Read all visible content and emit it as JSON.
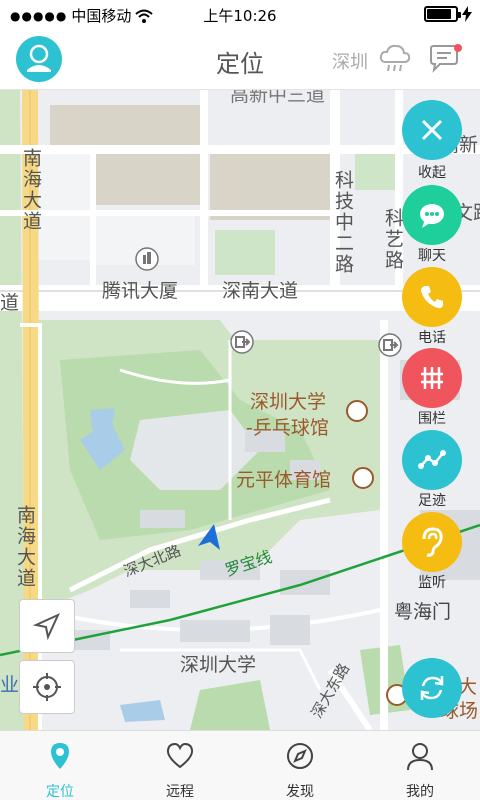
{
  "status_bar": {
    "carrier": "中国移动",
    "time": "上午10:26",
    "signal_icon": "signal-dots-icon",
    "wifi_icon": "wifi-icon",
    "battery_level": 0.85,
    "charging_icon": "lightning-icon"
  },
  "nav": {
    "title": "定位",
    "city": "深圳",
    "weather_icon": "cloud-rain-icon",
    "avatar_icon": "avatar-icon",
    "message_icon": "message-icon",
    "has_notification": true
  },
  "map": {
    "labels": {
      "tencent": "腾讯大厦",
      "shennan": "深南大道",
      "nanhai_top": "南海大道",
      "nanhai_bottom": "南海大道",
      "dao_left": "道",
      "keji": "科技中二路",
      "keyi": "科艺路",
      "gaoxin_right": "高新",
      "wendao": "文路",
      "top_road": "高新中三道",
      "szu_pingpong_1": "深圳大学",
      "szu_pingpong_2": "-乒乓球馆",
      "yuanping": "元平体育馆",
      "shenda_north": "深大北路",
      "luobao": "罗宝线",
      "yuehaimen": "粤海门",
      "szu": "深圳大学",
      "shenda_east": "深大东路",
      "ye_left": "业",
      "right_partial_1": "大",
      "right_partial_2": "球场"
    },
    "line_color": "#1fa23a",
    "location_arrow_color": "#1c6fd6"
  },
  "side_buttons": [
    {
      "label": "收起",
      "icon": "close-icon",
      "color": "#2cc2d1"
    },
    {
      "label": "聊天",
      "icon": "chat-icon",
      "color": "#1fcf9b"
    },
    {
      "label": "电话",
      "icon": "phone-icon",
      "color": "#f5bd12"
    },
    {
      "label": "围栏",
      "icon": "fence-icon",
      "color": "#f0555d"
    },
    {
      "label": "足迹",
      "icon": "track-icon",
      "color": "#2cc2d1"
    },
    {
      "label": "监听",
      "icon": "ear-icon",
      "color": "#f5bd12"
    }
  ],
  "refresh_icon": "refresh-icon",
  "map_tools": {
    "navigate_icon": "navigate-icon",
    "locate_icon": "locate-icon"
  },
  "tabs": [
    {
      "label": "定位",
      "icon": "location-pin-icon",
      "active": true
    },
    {
      "label": "远程",
      "icon": "heart-icon",
      "active": false
    },
    {
      "label": "发现",
      "icon": "compass-icon",
      "active": false
    },
    {
      "label": "我的",
      "icon": "user-icon",
      "active": false
    }
  ],
  "colors": {
    "accent": "#2cc2d1"
  }
}
